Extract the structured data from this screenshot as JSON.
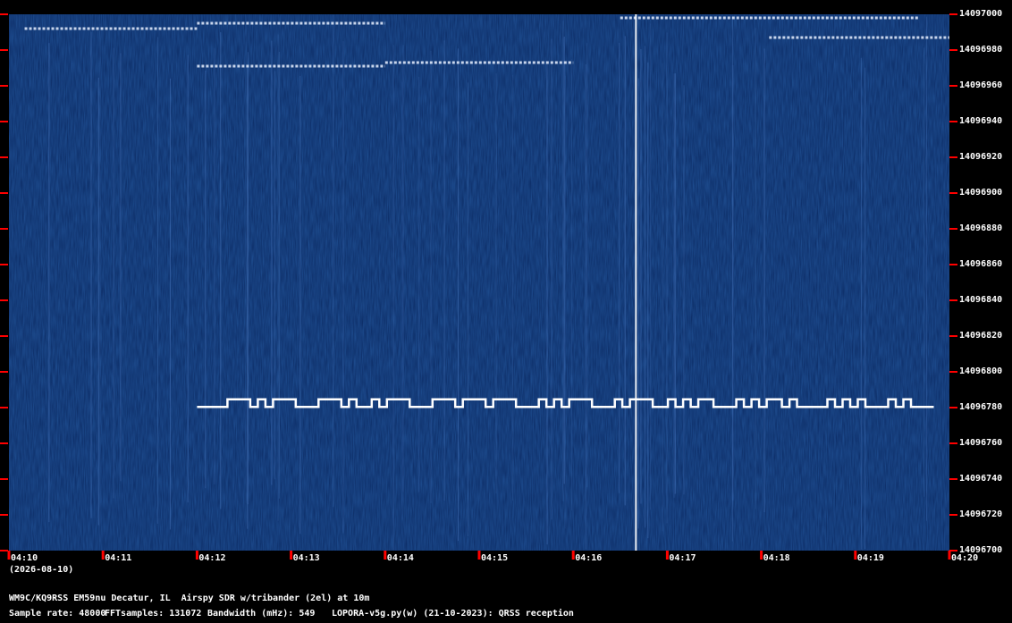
{
  "chart_data": {
    "type": "heatmap",
    "description_text": {
      "date_label": "(2026-08-10)",
      "station_line": "WM9C/KQ9RSS EM59nu Decatur, IL  Airspy SDR w/tribander (2el) at 10m",
      "params": {
        "sample_rate": "Sample rate: 48000",
        "fft_samples": "FFTsamples: 131072",
        "bandwidth": "Bandwidth (mHz): 549",
        "software": "LOPORA-v5g.py(w) (21-10-2023): QRSS reception"
      }
    },
    "x_ticks": [
      "04:10",
      "04:11",
      "04:12",
      "04:13",
      "04:14",
      "04:15",
      "04:16",
      "04:17",
      "04:18",
      "04:19",
      "04:20"
    ],
    "y_ticks": [
      "14097000",
      "14096980",
      "14096960",
      "14096940",
      "14096920",
      "14096900",
      "14096880",
      "14096860",
      "14096840",
      "14096820",
      "14096800",
      "14096780",
      "14096760",
      "14096740",
      "14096720",
      "14096700"
    ],
    "xlim": [
      "04:10",
      "04:20"
    ],
    "ylim": [
      14096700,
      14097000
    ],
    "colors": {
      "background": "#0b2a63",
      "signal": "#ffffff",
      "tick": "#ff0000"
    },
    "fsk_signal": {
      "start": "04:12",
      "end": "04:19:50",
      "low_hz": 14096780.4,
      "high_hz": 14096784.6,
      "pattern": [
        0,
        0,
        0,
        0,
        1,
        1,
        1,
        0,
        1,
        0,
        1,
        1,
        1,
        0,
        0,
        0,
        1,
        1,
        1,
        0,
        1,
        0,
        0,
        1,
        0,
        1,
        1,
        1,
        0,
        0,
        0,
        1,
        1,
        1,
        0,
        1,
        1,
        1,
        0,
        1,
        1,
        1,
        0,
        0,
        0,
        1,
        0,
        1,
        0,
        1,
        1,
        1,
        0,
        0,
        0,
        1,
        0,
        1,
        1,
        1,
        0,
        0,
        1,
        0,
        1,
        0,
        1,
        1,
        0,
        0,
        0,
        1,
        0,
        1,
        0,
        1,
        1,
        0,
        1,
        0,
        0,
        0,
        0,
        1,
        0,
        1,
        0,
        1,
        0,
        0,
        0,
        1,
        0,
        1,
        0,
        0,
        0
      ]
    },
    "bursts": [
      {
        "start": "04:10:10",
        "end": "04:12",
        "hz": 14096992
      },
      {
        "start": "04:12",
        "end": "04:14",
        "hz": 14096995
      },
      {
        "start": "04:12",
        "end": "04:14",
        "hz": 14096971
      },
      {
        "start": "04:14",
        "end": "04:16",
        "hz": 14096973
      },
      {
        "start": "04:16:30",
        "end": "04:19:40",
        "hz": 14096998
      },
      {
        "start": "04:18:05",
        "end": "04:20",
        "hz": 14096987
      }
    ],
    "carrier": {
      "time": "04:16:40"
    }
  }
}
